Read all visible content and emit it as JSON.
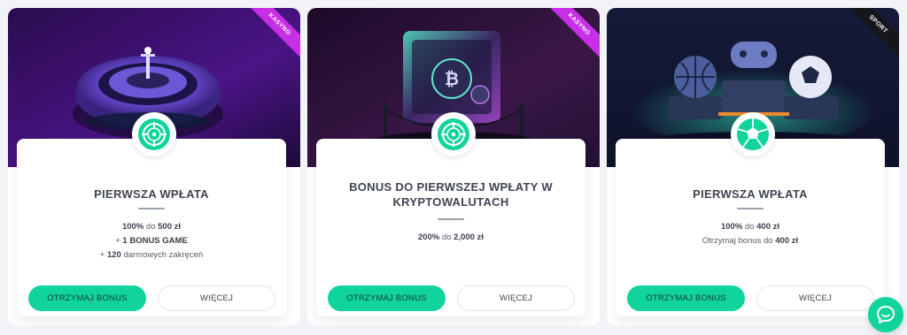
{
  "cards": [
    {
      "ribbon": "KASYNO",
      "ribbon_color": "#c62fe6",
      "badge_icon": "roulette-icon",
      "title": "PIERWSZA WPŁATA",
      "lines": [
        {
          "b1": "100%",
          "t1": " do ",
          "b2": "500 zł",
          "t2": ""
        },
        {
          "b1": "",
          "t1": "+ ",
          "b2": "1 BONUS GAME",
          "t2": ""
        },
        {
          "b1": "",
          "t1": "+ ",
          "b2": "120",
          "t2": " darmowych zakręceń"
        }
      ],
      "primary_button": "OTRZYMAJ BONUS",
      "secondary_button": "WIĘCEJ"
    },
    {
      "ribbon": "KASYNO",
      "ribbon_color": "#c62fe6",
      "badge_icon": "roulette-icon",
      "title_line1": "BONUS DO PIERWSZEJ WPŁATY W",
      "title_line2": "KRYPTOWALUTACH",
      "lines": [
        {
          "b1": "200%",
          "t1": " do ",
          "b2": "2,000 zł",
          "t2": ""
        }
      ],
      "primary_button": "OTRZYMAJ BONUS",
      "secondary_button": "WIĘCEJ"
    },
    {
      "ribbon": "SPORT",
      "ribbon_color": "#15151c",
      "badge_icon": "soccer-ball-icon",
      "title": "PIERWSZA WPŁATA",
      "lines": [
        {
          "b1": "100%",
          "t1": " do ",
          "b2": "400 zł",
          "t2": ""
        },
        {
          "b1": "",
          "t1": "Otrzymaj bonus do ",
          "b2": "400 zł",
          "t2": ""
        }
      ],
      "primary_button": "OTRZYMAJ BONUS",
      "secondary_button": "WIĘCEJ"
    }
  ],
  "chat_icon": "chat-bubble-icon",
  "colors": {
    "accent": "#10d49b",
    "title": "#3e4452",
    "background": "#f2f3f7"
  }
}
